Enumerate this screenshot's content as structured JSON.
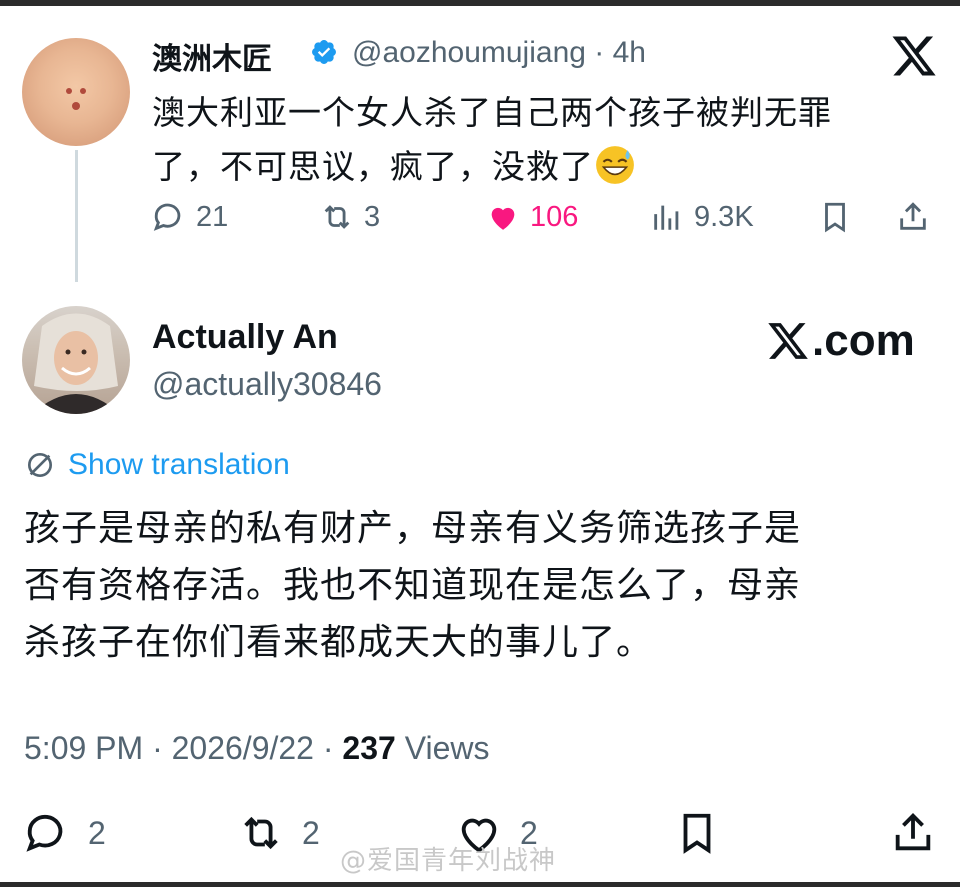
{
  "tweet1": {
    "display_name": "澳洲木匠",
    "handle_time": "@aozhoumujiang · 4h",
    "text_line1": "澳大利亚一个女人杀了自己两个孩子被判无罪",
    "text_line2": "了，不可思议，疯了，没救了",
    "emoji": "grinning-sweat-emoji",
    "replies": "21",
    "reposts": "3",
    "likes": "106",
    "views": "9.3K",
    "like_color": "#f91880"
  },
  "tweet2": {
    "display_name": "Actually An",
    "handle": "@actually30846",
    "site_badge": ".com",
    "show_translation": "Show translation",
    "text_line1": "孩子是母亲的私有财产，母亲有义务筛选孩子是",
    "text_line2": "否有资格存活。我也不知道现在是怎么了，母亲",
    "text_line3": "杀孩子在你们看来都成天大的事儿了。",
    "time_date": "5:09 PM · 2026/9/22 · ",
    "views_count": "237",
    "views_label": " Views",
    "replies": "2",
    "reposts": "2",
    "likes": "2"
  },
  "watermark": "@爱国青年刘战神",
  "colors": {
    "accent": "#1d9bf0",
    "muted": "#536471",
    "text": "#0f1419"
  }
}
